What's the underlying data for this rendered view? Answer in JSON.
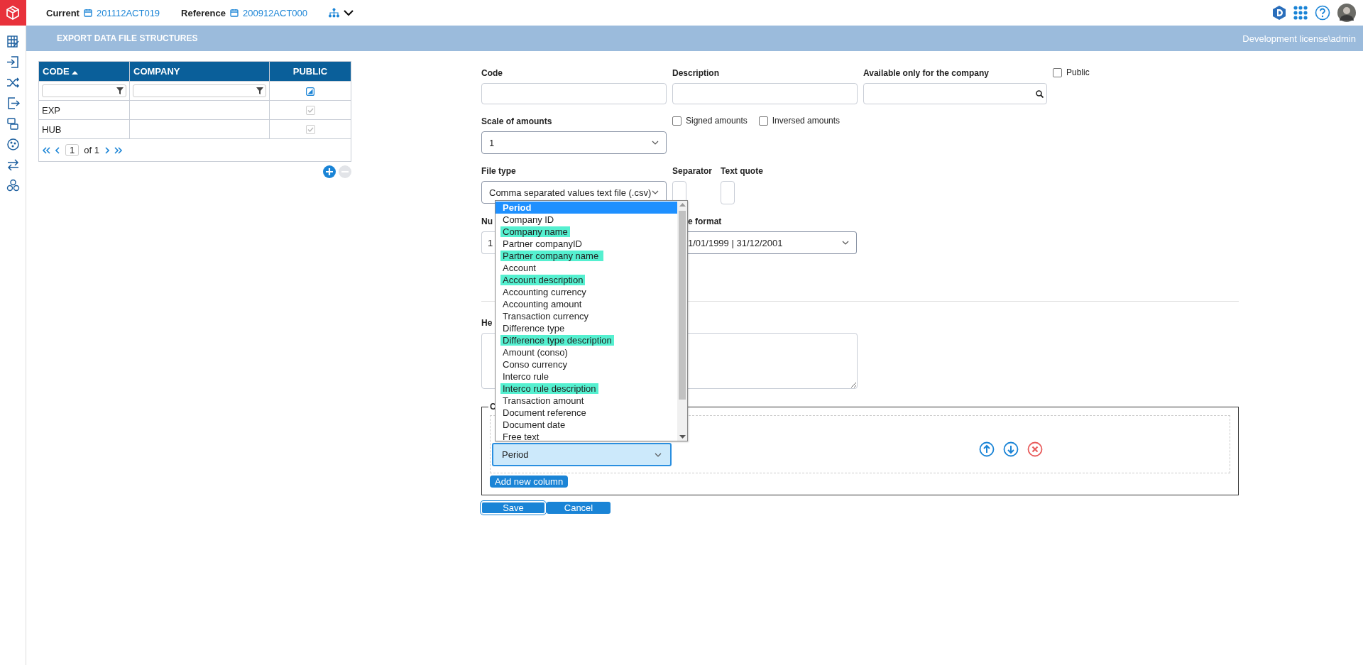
{
  "topbar": {
    "current_label": "Current",
    "current_value": "201112ACT019",
    "reference_label": "Reference",
    "reference_value": "200912ACT000"
  },
  "header": {
    "title": "EXPORT DATA FILE STRUCTURES",
    "user": "Development license\\admin"
  },
  "table": {
    "columns": [
      {
        "label": "CODE",
        "sorted": true
      },
      {
        "label": "COMPANY",
        "sorted": false
      },
      {
        "label": "PUBLIC",
        "sorted": false
      }
    ],
    "rows": [
      {
        "code": "EXP",
        "public": true
      },
      {
        "code": "HUB",
        "public": true
      }
    ],
    "public_filter": {
      "indeterminate": true
    },
    "pager": {
      "page": "1",
      "of_label": "of 1"
    }
  },
  "form": {
    "code": {
      "label": "Code"
    },
    "description": {
      "label": "Description"
    },
    "company": {
      "label": "Available only for the company"
    },
    "public": {
      "label": "Public",
      "checked": false
    },
    "scale": {
      "label": "Scale of amounts",
      "value": "1"
    },
    "signed": {
      "label": "Signed amounts",
      "checked": false
    },
    "inversed": {
      "label": "Inversed amounts",
      "checked": false
    },
    "file_type": {
      "label": "File type",
      "value": "Comma separated values text file (.csv)"
    },
    "separator": {
      "label": "Separator"
    },
    "text_quote": {
      "label": "Text quote"
    },
    "number_format": {
      "label": "Nu",
      "value": "1"
    },
    "date_format": {
      "label": "e format",
      "value": "1/01/1999 | 31/12/2001"
    },
    "header_text": {
      "label": "He"
    },
    "columns_group": {
      "legend": "C",
      "column_value": "Period",
      "add_button": "Add new column"
    },
    "buttons": [
      {
        "label": "Save",
        "focused": true
      },
      {
        "label": "Cancel",
        "focused": false
      }
    ]
  },
  "dropdown": {
    "options": [
      {
        "label": "Period",
        "selected": true,
        "highlighted": false
      },
      {
        "label": "Company ID",
        "selected": false,
        "highlighted": false
      },
      {
        "label": "Company name",
        "selected": false,
        "highlighted": true
      },
      {
        "label": "Partner companyID",
        "selected": false,
        "highlighted": false
      },
      {
        "label": "Partner company name ",
        "selected": false,
        "highlighted": true
      },
      {
        "label": "Account",
        "selected": false,
        "highlighted": false
      },
      {
        "label": "Account description",
        "selected": false,
        "highlighted": true
      },
      {
        "label": "Accounting currency",
        "selected": false,
        "highlighted": false
      },
      {
        "label": "Accounting amount",
        "selected": false,
        "highlighted": false
      },
      {
        "label": "Transaction currency",
        "selected": false,
        "highlighted": false
      },
      {
        "label": "Difference type",
        "selected": false,
        "highlighted": false
      },
      {
        "label": "Difference type description",
        "selected": false,
        "highlighted": true
      },
      {
        "label": "Amount (conso)",
        "selected": false,
        "highlighted": false
      },
      {
        "label": "Conso currency",
        "selected": false,
        "highlighted": false
      },
      {
        "label": "Interco rule",
        "selected": false,
        "highlighted": false
      },
      {
        "label": "Interco rule description",
        "selected": false,
        "highlighted": true
      },
      {
        "label": "Transaction amount",
        "selected": false,
        "highlighted": false
      },
      {
        "label": "Document reference",
        "selected": false,
        "highlighted": false
      },
      {
        "label": "Document date",
        "selected": false,
        "highlighted": false
      },
      {
        "label": "Free text",
        "selected": false,
        "highlighted": false
      }
    ]
  }
}
